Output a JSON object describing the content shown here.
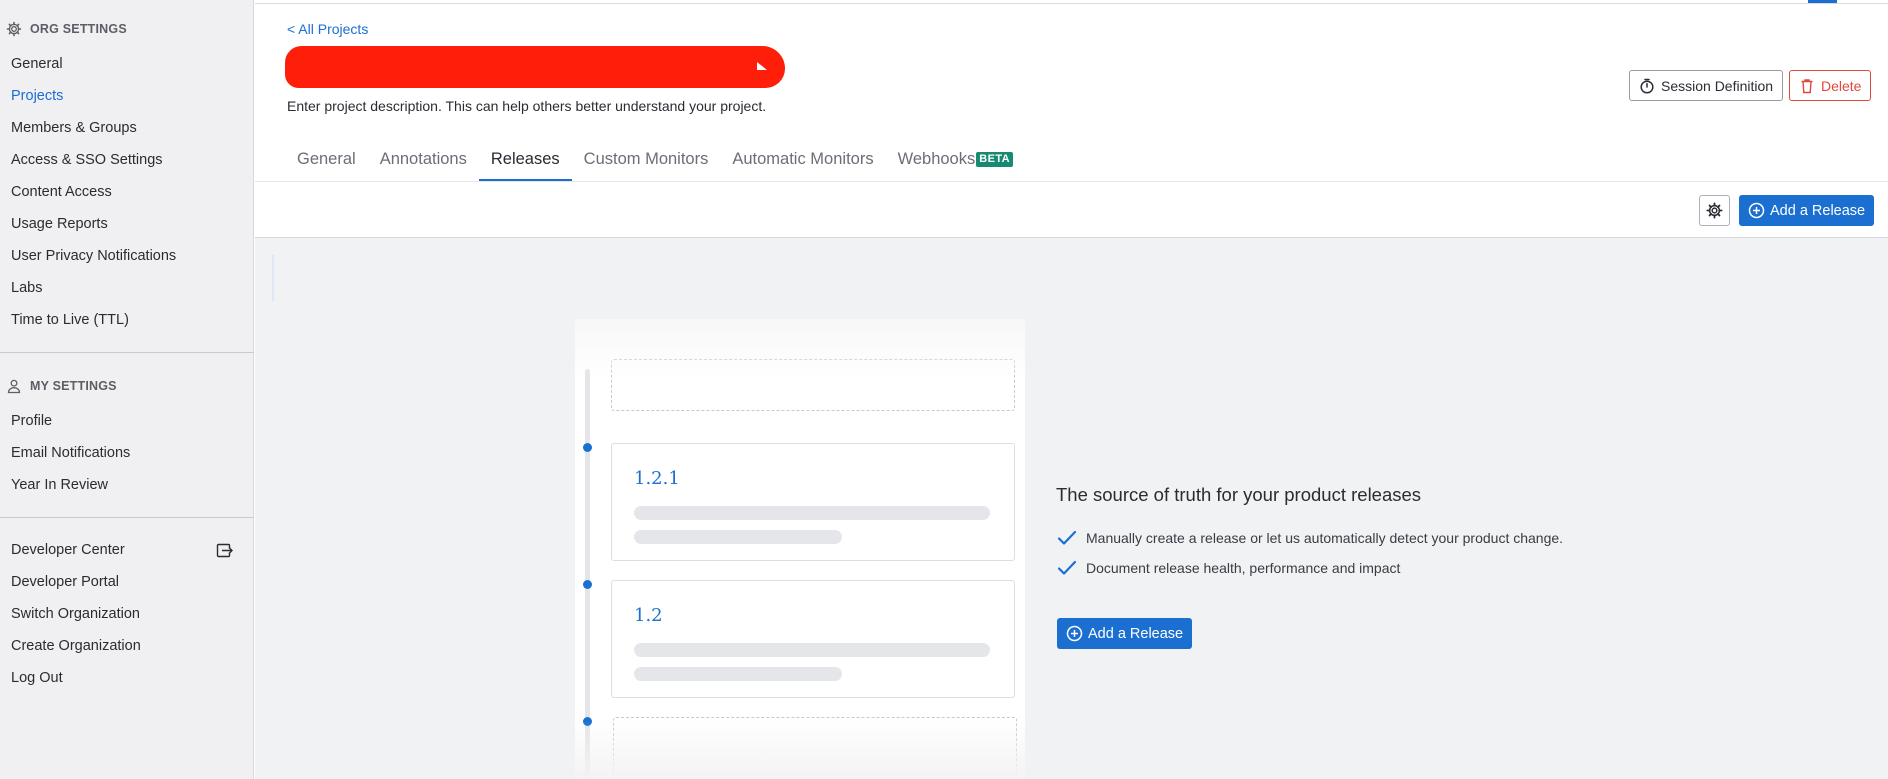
{
  "sidebar": {
    "org_header": "ORG SETTINGS",
    "org_items": [
      {
        "label": "General"
      },
      {
        "label": "Projects"
      },
      {
        "label": "Members & Groups"
      },
      {
        "label": "Access & SSO Settings"
      },
      {
        "label": "Content Access"
      },
      {
        "label": "Usage Reports"
      },
      {
        "label": "User Privacy Notifications"
      },
      {
        "label": "Labs"
      },
      {
        "label": "Time to Live (TTL)"
      }
    ],
    "my_header": "MY SETTINGS",
    "my_items": [
      {
        "label": "Profile"
      },
      {
        "label": "Email Notifications"
      },
      {
        "label": "Year In Review"
      }
    ],
    "other_items": [
      {
        "label": "Developer Center"
      },
      {
        "label": "Developer Portal"
      },
      {
        "label": "Switch Organization"
      },
      {
        "label": "Create Organization"
      },
      {
        "label": "Log Out"
      }
    ]
  },
  "header": {
    "back_link": "< All Projects",
    "description": "Enter project description. This can help others better understand your project.",
    "session_definition_label": "Session Definition",
    "delete_label": "Delete"
  },
  "tabs": [
    {
      "label": "General"
    },
    {
      "label": "Annotations"
    },
    {
      "label": "Releases"
    },
    {
      "label": "Custom Monitors"
    },
    {
      "label": "Automatic Monitors"
    },
    {
      "label": "Webhooks",
      "badge": "BETA"
    }
  ],
  "toolbar": {
    "add_release_label": "Add a Release"
  },
  "illustration": {
    "versions": [
      "1.2.1",
      "1.2"
    ]
  },
  "empty_state": {
    "title": "The source of truth for your product releases",
    "bullets": [
      "Manually create a release or let us automatically detect your product change.",
      "Document release health, performance and impact"
    ],
    "button_label": "Add a Release"
  },
  "colors": {
    "accent": "#1a6fd1",
    "danger": "#e0483e",
    "beta_badge": "#178a73",
    "redaction": "#ff1e0a"
  }
}
